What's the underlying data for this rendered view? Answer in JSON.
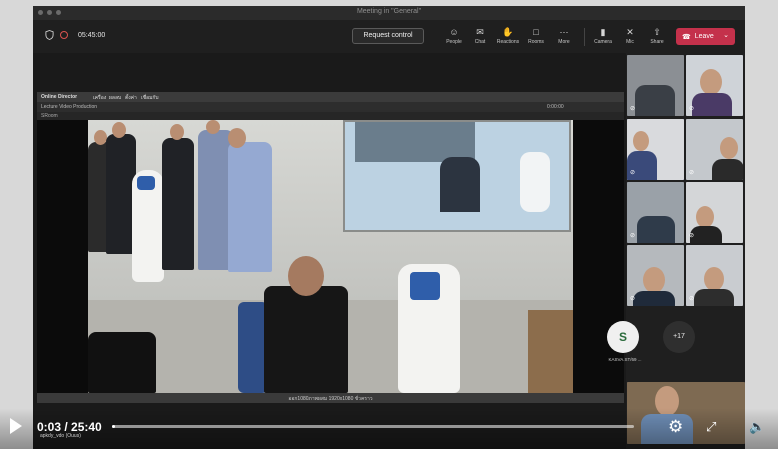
{
  "window": {
    "title": "Meeting in \"General\""
  },
  "toolbar": {
    "timer": "05:45:00",
    "request_control": "Request control",
    "buttons": [
      {
        "label": "People",
        "icon": "people-icon"
      },
      {
        "label": "Chat",
        "icon": "chat-icon"
      },
      {
        "label": "Reactions",
        "icon": "reactions-icon"
      },
      {
        "label": "Rooms",
        "icon": "rooms-icon"
      },
      {
        "label": "More",
        "icon": "more-icon"
      },
      {
        "label": "Camera",
        "icon": "camera-icon"
      },
      {
        "label": "Mic",
        "icon": "mic-icon"
      },
      {
        "label": "Share",
        "icon": "share-icon"
      }
    ],
    "leave": "Leave"
  },
  "shared_screen": {
    "app_title": "Online Director",
    "menu": [
      "เครื่อง",
      "ผลลบ",
      "ตั้งค่า",
      "เชื่อมกับ"
    ],
    "project": "Lecture Video Production",
    "clock": "0:00:00",
    "source": "SRoom",
    "status": "ออก1080ภาพผสม 1920x1080 ชั่วคราว"
  },
  "participants": {
    "avatar_initial": "S",
    "avatar_name": "KASVA.ST/69 ...",
    "more": "+17"
  },
  "player": {
    "time": "0:03 / 25:40",
    "uploader": "apkdy_vdo (Ouus)",
    "progress": 0.002
  },
  "colors": {
    "leave": "#c4314b",
    "active_tile": "#6b70e0",
    "accent": "#2f5eaa"
  }
}
